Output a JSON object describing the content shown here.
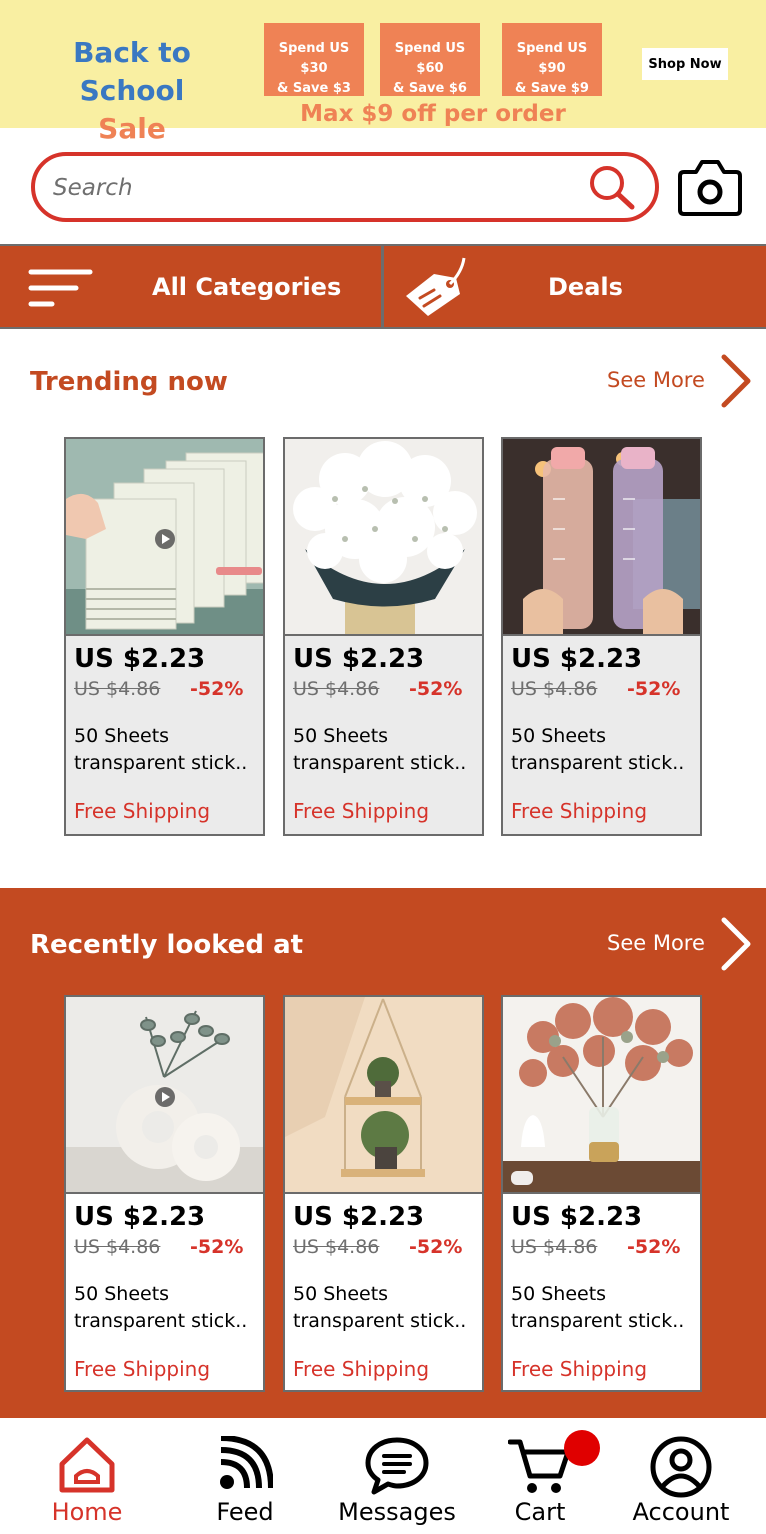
{
  "colors": {
    "accent": "#c34a21",
    "red": "#d6332a",
    "banner_bg": "#f9efa2",
    "coupon": "#ef8255",
    "blue": "#3a78c2"
  },
  "banner": {
    "title_line1": "Back to School",
    "title_line2": "Sale",
    "coupons": [
      {
        "line1": "Spend US $30",
        "line2": "& Save $3"
      },
      {
        "line1": "Spend US $60",
        "line2": "& Save $6"
      },
      {
        "line1": "Spend US $90",
        "line2": "& Save $9"
      }
    ],
    "note": "Max $9 off per order",
    "cta": "Shop Now"
  },
  "search": {
    "placeholder": "Search",
    "value": "",
    "search_icon": "search-icon",
    "camera_icon": "camera-icon"
  },
  "categories": {
    "all_label": "All Categories",
    "all_icon": "menu-icon",
    "deals_label": "Deals",
    "deals_icon": "tag-icon"
  },
  "trending": {
    "title": "Trending now",
    "see_more": "See More",
    "products": [
      {
        "image": "sticky-notes-photo",
        "price": "US $2.23",
        "old_price": "US $4.86",
        "discount": "-52%",
        "name_line1": "50 Sheets",
        "name_line2": "transparent stick..",
        "shipping": "Free Shipping"
      },
      {
        "image": "babys-breath-flowers-photo",
        "price": "US $2.23",
        "old_price": "US $4.86",
        "discount": "-52%",
        "name_line1": "50 Sheets",
        "name_line2": "transparent stick..",
        "shipping": "Free Shipping"
      },
      {
        "image": "water-bottles-photo",
        "price": "US $2.23",
        "old_price": "US $4.86",
        "discount": "-52%",
        "name_line1": "50 Sheets",
        "name_line2": "transparent stick..",
        "shipping": "Free Shipping"
      }
    ]
  },
  "recent": {
    "title": "Recently looked at",
    "see_more": "See More",
    "products": [
      {
        "image": "donut-vases-photo",
        "price": "US $2.23",
        "old_price": "US $4.86",
        "discount": "-52%",
        "name_line1": "50 Sheets",
        "name_line2": "transparent stick..",
        "shipping": "Free Shipping"
      },
      {
        "image": "hanging-shelf-photo",
        "price": "US $2.23",
        "old_price": "US $4.86",
        "discount": "-52%",
        "name_line1": "50 Sheets",
        "name_line2": "transparent stick..",
        "shipping": "Free Shipping"
      },
      {
        "image": "eucalyptus-vase-photo",
        "price": "US $2.23",
        "old_price": "US $4.86",
        "discount": "-52%",
        "name_line1": "50 Sheets",
        "name_line2": "transparent stick..",
        "shipping": "Free Shipping"
      }
    ]
  },
  "nav": {
    "items": [
      {
        "label": "Home",
        "icon": "home-icon",
        "active": true
      },
      {
        "label": "Feed",
        "icon": "feed-icon",
        "active": false
      },
      {
        "label": "Messages",
        "icon": "messages-icon",
        "active": false
      },
      {
        "label": "Cart",
        "icon": "cart-icon",
        "active": false
      },
      {
        "label": "Account",
        "icon": "account-icon",
        "active": false
      }
    ]
  }
}
